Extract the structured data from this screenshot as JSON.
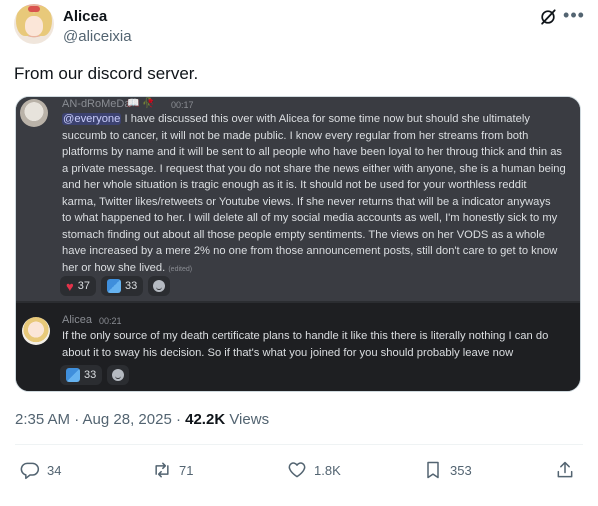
{
  "tweet": {
    "author_name": "Alicea",
    "author_handle": "@aliceixia",
    "text": "From our discord server.",
    "timestamp": "2:35 AM · Aug 28, 2025 · ",
    "views_count": "42.2K",
    "views_label": " Views"
  },
  "discord": {
    "msg1": {
      "author": "AN-dRoMeDa",
      "badges": "📖 🥀",
      "time": "00:17",
      "mention": "@everyone",
      "body": " I have discussed this over with Alicea for some time now but should she ultimately\nsuccumb to cancer, it will not be made public. I know every regular from her streams from both\nplatforms by name and it will be sent to all people who have been loyal to her throug thick and thin as\na private message. I request that you do not share the news either with anyone, she is a human being\nand her whole situation is tragic enough as it is. It should not be used for your worthless reddit\nkarma, Twitter likes/retweets or Youtube views. If she never returns that will be a indicator anyways\nto what happened to her. I will delete all of my social media accounts as well, I'm honestly sick to my\nstomach finding out about all those people empty sentiments. The views on her VODS as a whole\nhave increased by a mere 2% no one from those announcement posts, still don't care to get to know\nher or how she lived. ",
      "edited": "(edited)",
      "reactions": [
        {
          "icon": "heart-icon",
          "count": "37"
        },
        {
          "icon": "figure-icon",
          "count": "33"
        }
      ]
    },
    "msg2": {
      "author": "Alicea",
      "time": "00:21",
      "body": "If the only source of my death certificate plans to handle it like this there is literally nothing I can do\nabout it to sway his decision. So if that's what you joined for you should probably leave now",
      "reactions": [
        {
          "icon": "figure-icon",
          "count": "33"
        }
      ]
    }
  },
  "actions": {
    "replies": "34",
    "reposts": "71",
    "likes": "1.8K",
    "bookmarks": "353"
  }
}
